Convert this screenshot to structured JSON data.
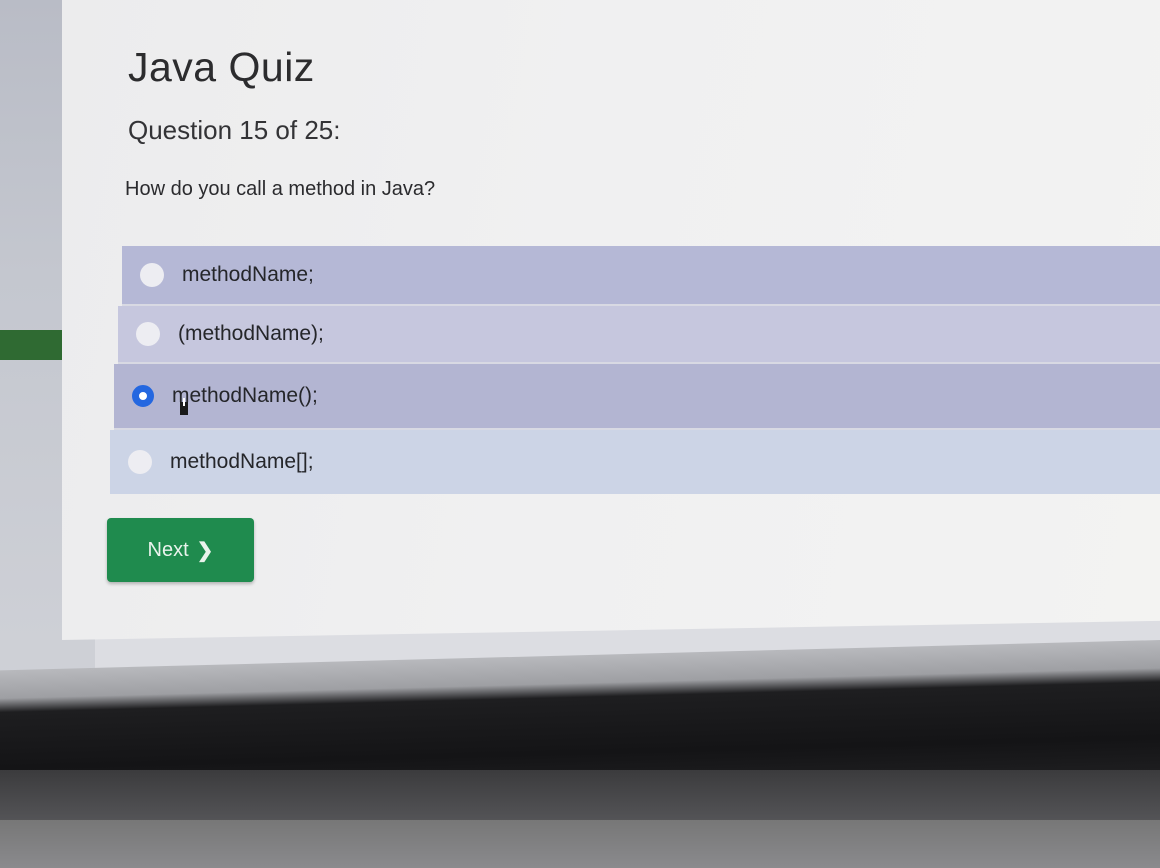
{
  "quiz": {
    "title": "Java Quiz",
    "progress": "Question 15 of 25:",
    "question": "How do you call a method in Java?",
    "options": [
      {
        "label": "methodName;",
        "selected": false
      },
      {
        "label": "(methodName);",
        "selected": false
      },
      {
        "label": "methodName();",
        "selected": true
      },
      {
        "label": "methodName[];",
        "selected": false
      }
    ],
    "next_label": "Next"
  },
  "icons": {
    "next_chevron": "chevron-right-icon",
    "cursor": "text-cursor-icon"
  },
  "colors": {
    "next_button": "#1f8b4e",
    "selected_radio": "#2467e0",
    "option_row": "#b5b8d6"
  }
}
